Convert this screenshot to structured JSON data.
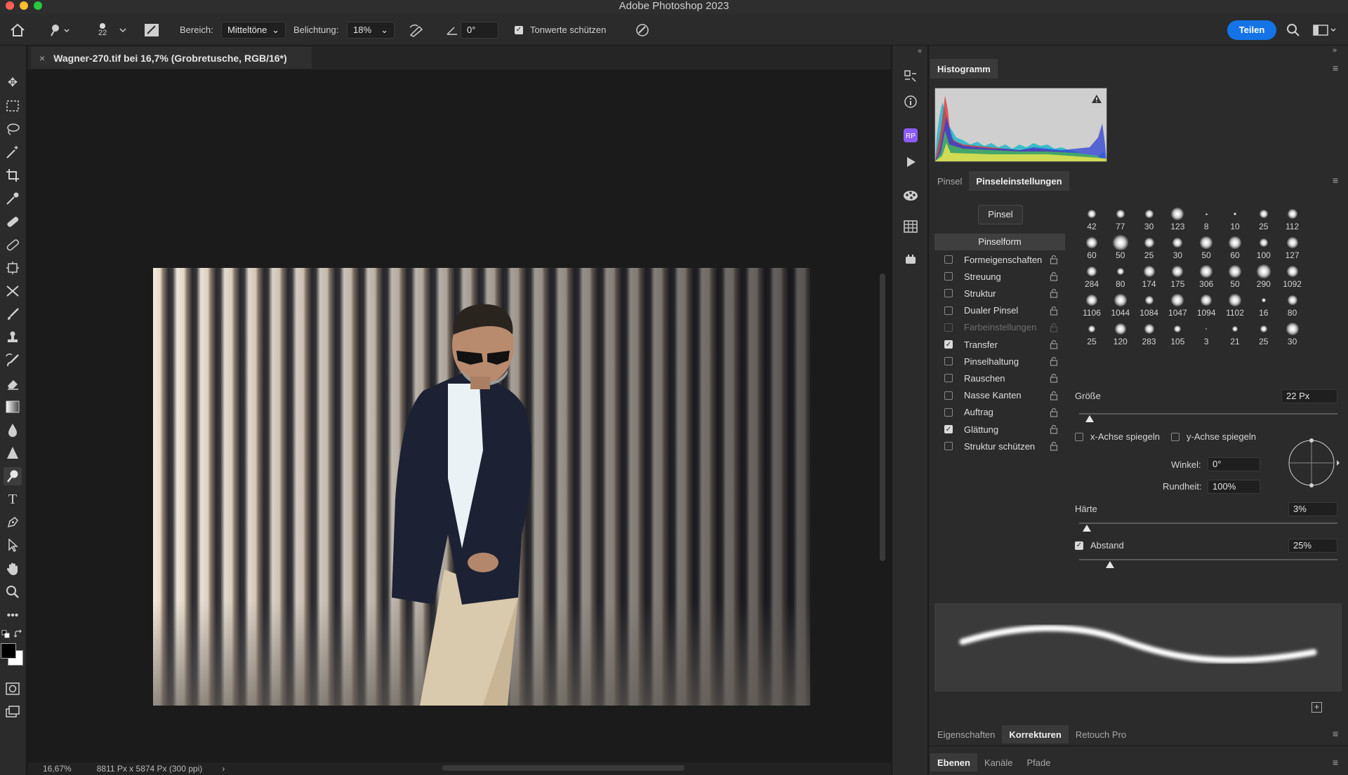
{
  "app": {
    "title": "Adobe Photoshop 2023"
  },
  "options_bar": {
    "brush_size": "22",
    "range_label": "Bereich:",
    "range_value": "Mitteltöne",
    "exposure_label": "Belichtung:",
    "exposure_value": "18%",
    "angle_value": "0°",
    "protect_tones_label": "Tonwerte schützen",
    "share_label": "Teilen"
  },
  "document": {
    "tab_title": "Wagner-270.tif bei 16,7% (Grobretusche, RGB/16*)",
    "zoom": "16,67%",
    "dimensions": "8811 Px x 5874 Px (300 ppi)"
  },
  "histogram": {
    "title": "Histogramm"
  },
  "brush_panel": {
    "tabs": [
      "Pinsel",
      "Pinseleinstellungen"
    ],
    "brush_button": "Pinsel",
    "section": "Pinselform",
    "options": [
      {
        "label": "Formeigenschaften",
        "checked": false,
        "disabled": false
      },
      {
        "label": "Streuung",
        "checked": false,
        "disabled": false
      },
      {
        "label": "Struktur",
        "checked": false,
        "disabled": false
      },
      {
        "label": "Dualer Pinsel",
        "checked": false,
        "disabled": false
      },
      {
        "label": "Farbeinstellungen",
        "checked": false,
        "disabled": true
      },
      {
        "label": "Transfer",
        "checked": true,
        "disabled": false
      },
      {
        "label": "Pinselhaltung",
        "checked": false,
        "disabled": false
      },
      {
        "label": "Rauschen",
        "checked": false,
        "disabled": false
      },
      {
        "label": "Nasse Kanten",
        "checked": false,
        "disabled": false
      },
      {
        "label": "Auftrag",
        "checked": false,
        "disabled": false
      },
      {
        "label": "Glättung",
        "checked": true,
        "disabled": false
      },
      {
        "label": "Struktur schützen",
        "checked": false,
        "disabled": false
      }
    ],
    "tip_sizes": [
      [
        "42",
        "77",
        "30",
        "123",
        "8",
        "10",
        "25",
        "112"
      ],
      [
        "60",
        "50",
        "25",
        "30",
        "50",
        "60",
        "100",
        "127"
      ],
      [
        "284",
        "80",
        "174",
        "175",
        "306",
        "50",
        "290",
        "1092"
      ],
      [
        "1106",
        "1044",
        "1084",
        "1047",
        "1094",
        "1102",
        "16",
        "80"
      ],
      [
        "25",
        "120",
        "283",
        "105",
        "3",
        "21",
        "25",
        "30"
      ]
    ],
    "size_label": "Größe",
    "size_value": "22 Px",
    "flip_x_label": "x-Achse spiegeln",
    "flip_y_label": "y-Achse spiegeln",
    "angle_label": "Winkel:",
    "angle_value": "0°",
    "roundness_label": "Rundheit:",
    "roundness_value": "100%",
    "hardness_label": "Härte",
    "hardness_value": "3%",
    "spacing_label": "Abstand",
    "spacing_value": "25%",
    "size_level": 0.04,
    "hardness_level": 0.03,
    "spacing_level": 0.12
  },
  "bottom_tabs_1": [
    "Eigenschaften",
    "Korrekturen",
    "Retouch Pro"
  ],
  "bottom_tabs_2": [
    "Ebenen",
    "Kanäle",
    "Pfade"
  ]
}
